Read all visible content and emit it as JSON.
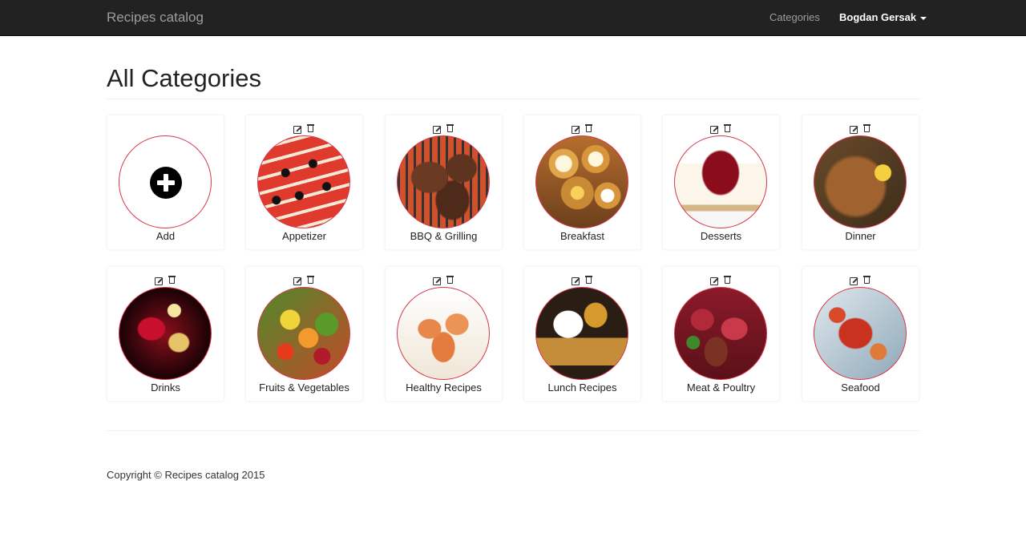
{
  "navbar": {
    "brand": "Recipes catalog",
    "categories_link": "Categories",
    "user_name": "Bogdan Gersak"
  },
  "page": {
    "title": "All Categories"
  },
  "add_tile": {
    "label": "Add"
  },
  "categories": [
    {
      "label": "Appetizer"
    },
    {
      "label": "BBQ & Grilling"
    },
    {
      "label": "Breakfast"
    },
    {
      "label": "Desserts"
    },
    {
      "label": "Dinner"
    },
    {
      "label": "Drinks"
    },
    {
      "label": "Fruits & Vegetables"
    },
    {
      "label": "Healthy Recipes"
    },
    {
      "label": "Lunch Recipes"
    },
    {
      "label": "Meat & Poultry"
    },
    {
      "label": "Seafood"
    }
  ],
  "icons": {
    "edit": "edit-icon",
    "delete": "trash-icon",
    "add": "plus-circle-icon"
  },
  "colors": {
    "navbar_bg": "#222222",
    "circle_border": "#d7374b"
  },
  "footer": {
    "copyright": "Copyright © Recipes catalog 2015"
  }
}
